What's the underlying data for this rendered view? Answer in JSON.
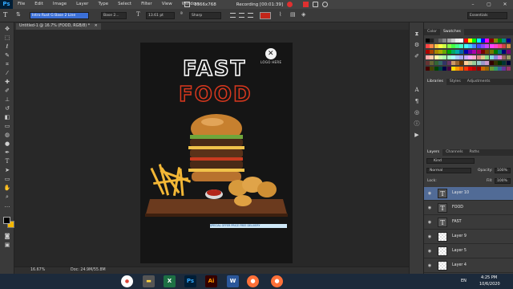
{
  "app": {
    "logo": "Ps"
  },
  "menu": [
    "File",
    "Edit",
    "Image",
    "Layer",
    "Type",
    "Select",
    "Filter",
    "View",
    "Window"
  ],
  "recorder": {
    "resolution": "1366x768",
    "status": "Recording [00:01:39]"
  },
  "options": {
    "font_family": "Intro Rust G Base 2 Line",
    "font_style": "Base 2...",
    "font_size": "13.61 pt",
    "antialias": "Sharp",
    "workspace": "Essentials"
  },
  "document": {
    "tab_title": "Untitled-1 @ 16.7% (FOOD, RGB/8) *",
    "zoom": "16.67%",
    "doc_size": "Doc: 24.9M/55.8M"
  },
  "poster": {
    "logo_text": "LOGO HERE",
    "headline_1": "FAST",
    "headline_2": "FOOD",
    "bottom_text": "SPECIAL OFFER PRICE FREE DELIVERY"
  },
  "panels": {
    "color_tabs": [
      "Color",
      "Swatches"
    ],
    "library_tabs": [
      "Libraries",
      "Styles",
      "Adjustments"
    ],
    "layer_tabs": [
      "Layers",
      "Channels",
      "Paths"
    ],
    "filter_label": "Kind",
    "blend_mode": "Normal",
    "opacity_label": "Opacity:",
    "opacity_value": "100%",
    "lock_label": "Lock:",
    "fill_label": "Fill:",
    "fill_value": "100%"
  },
  "layers": [
    {
      "name": "Layer 10",
      "type": "text",
      "selected": true
    },
    {
      "name": "FOOD",
      "type": "text",
      "selected": false
    },
    {
      "name": "FAST",
      "type": "text",
      "selected": false
    },
    {
      "name": "Layer 9",
      "type": "image",
      "selected": false
    },
    {
      "name": "Layer 5",
      "type": "image",
      "selected": false
    },
    {
      "name": "Layer 4",
      "type": "image",
      "selected": false
    }
  ],
  "colors": {
    "foreground": "#000000",
    "background": "#f5b800",
    "accent_red": "#d9381e",
    "layer_selected": "#516b96"
  },
  "taskbar": {
    "lang": "EN",
    "time": "4:25 PM",
    "date": "10/6/2020"
  }
}
